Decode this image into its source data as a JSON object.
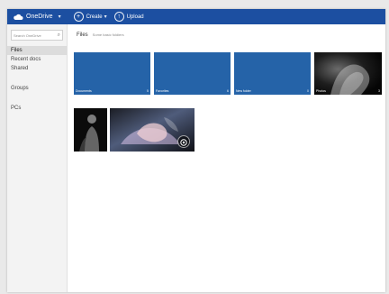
{
  "colors": {
    "topbar": "#1c4fa1",
    "folder": "#2563a8",
    "sidebar_bg": "#f3f3f3",
    "content_bg": "#ffffff"
  },
  "topbar": {
    "brand": "OneDrive",
    "create_label": "Create",
    "upload_label": "Upload"
  },
  "sidebar": {
    "search_placeholder": "Search OneDrive",
    "items": [
      {
        "label": "Files",
        "active": true
      },
      {
        "label": "Recent docs",
        "active": false
      },
      {
        "label": "Shared",
        "active": false
      },
      {
        "label": "Groups",
        "active": false
      },
      {
        "label": "PCs",
        "active": false
      }
    ]
  },
  "main": {
    "title": "Files",
    "subtitle": "Some basic foldiers",
    "folders": [
      {
        "label": "Documents",
        "count": "5"
      },
      {
        "label": "Favorites",
        "count": "6"
      },
      {
        "label": "New folder",
        "count": "0"
      }
    ],
    "photo_folder": {
      "label": "Photos",
      "count": "3"
    }
  },
  "icons": {
    "cloud": "cloud-icon",
    "search": "search-icon",
    "create": "plus-circle-icon",
    "upload": "upload-circle-icon",
    "video": "video-play-icon"
  }
}
